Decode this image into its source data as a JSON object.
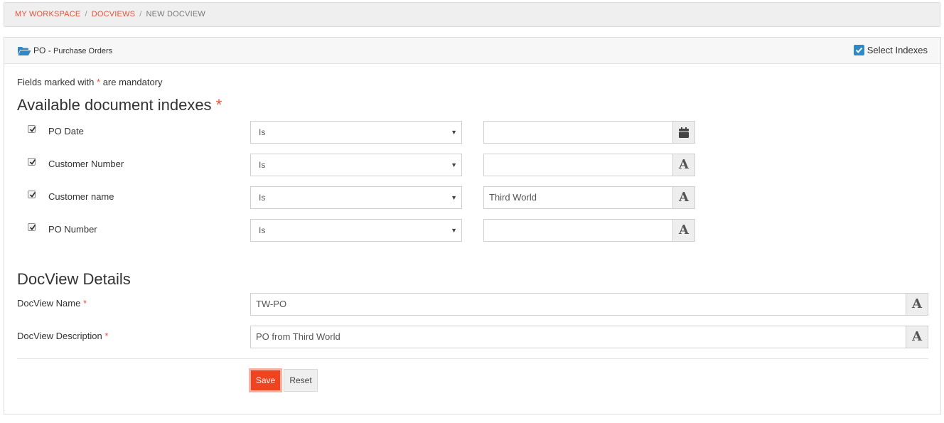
{
  "breadcrumb": {
    "items": [
      {
        "label": "MY WORKSPACE"
      },
      {
        "label": "DOCVIEWS"
      },
      {
        "label": "NEW DOCVIEW"
      }
    ],
    "separator": "/"
  },
  "panel": {
    "title_code": "PO",
    "title_dash": "-",
    "title_name": "Purchase Orders",
    "select_indexes_label": "Select Indexes",
    "select_indexes_checked": true
  },
  "form": {
    "mandatory_prefix": "Fields marked with",
    "mandatory_star": "*",
    "mandatory_suffix": "are mandatory",
    "indexes_heading": "Available document indexes",
    "indexes_star": "*",
    "indexes": [
      {
        "label": "PO Date",
        "checked": true,
        "operator": "Is",
        "value": "",
        "icon": "calendar-icon"
      },
      {
        "label": "Customer Number",
        "checked": true,
        "operator": "Is",
        "value": "",
        "icon": "text-type-icon"
      },
      {
        "label": "Customer name",
        "checked": true,
        "operator": "Is",
        "value": "Third World",
        "icon": "text-type-icon"
      },
      {
        "label": "PO Number",
        "checked": true,
        "operator": "Is",
        "value": "",
        "icon": "text-type-icon"
      }
    ],
    "details_heading": "DocView Details",
    "docview_name_label": "DocView Name",
    "docview_name_value": "TW-PO",
    "docview_desc_label": "DocView Description",
    "docview_desc_value": "PO from Third World",
    "required_star": "*",
    "text_icon_glyph": "A",
    "save_label": "Save",
    "reset_label": "Reset"
  },
  "colors": {
    "accent": "#e8503a",
    "save_button": "#f0431f",
    "checkbox_blue": "#2f88c7"
  }
}
